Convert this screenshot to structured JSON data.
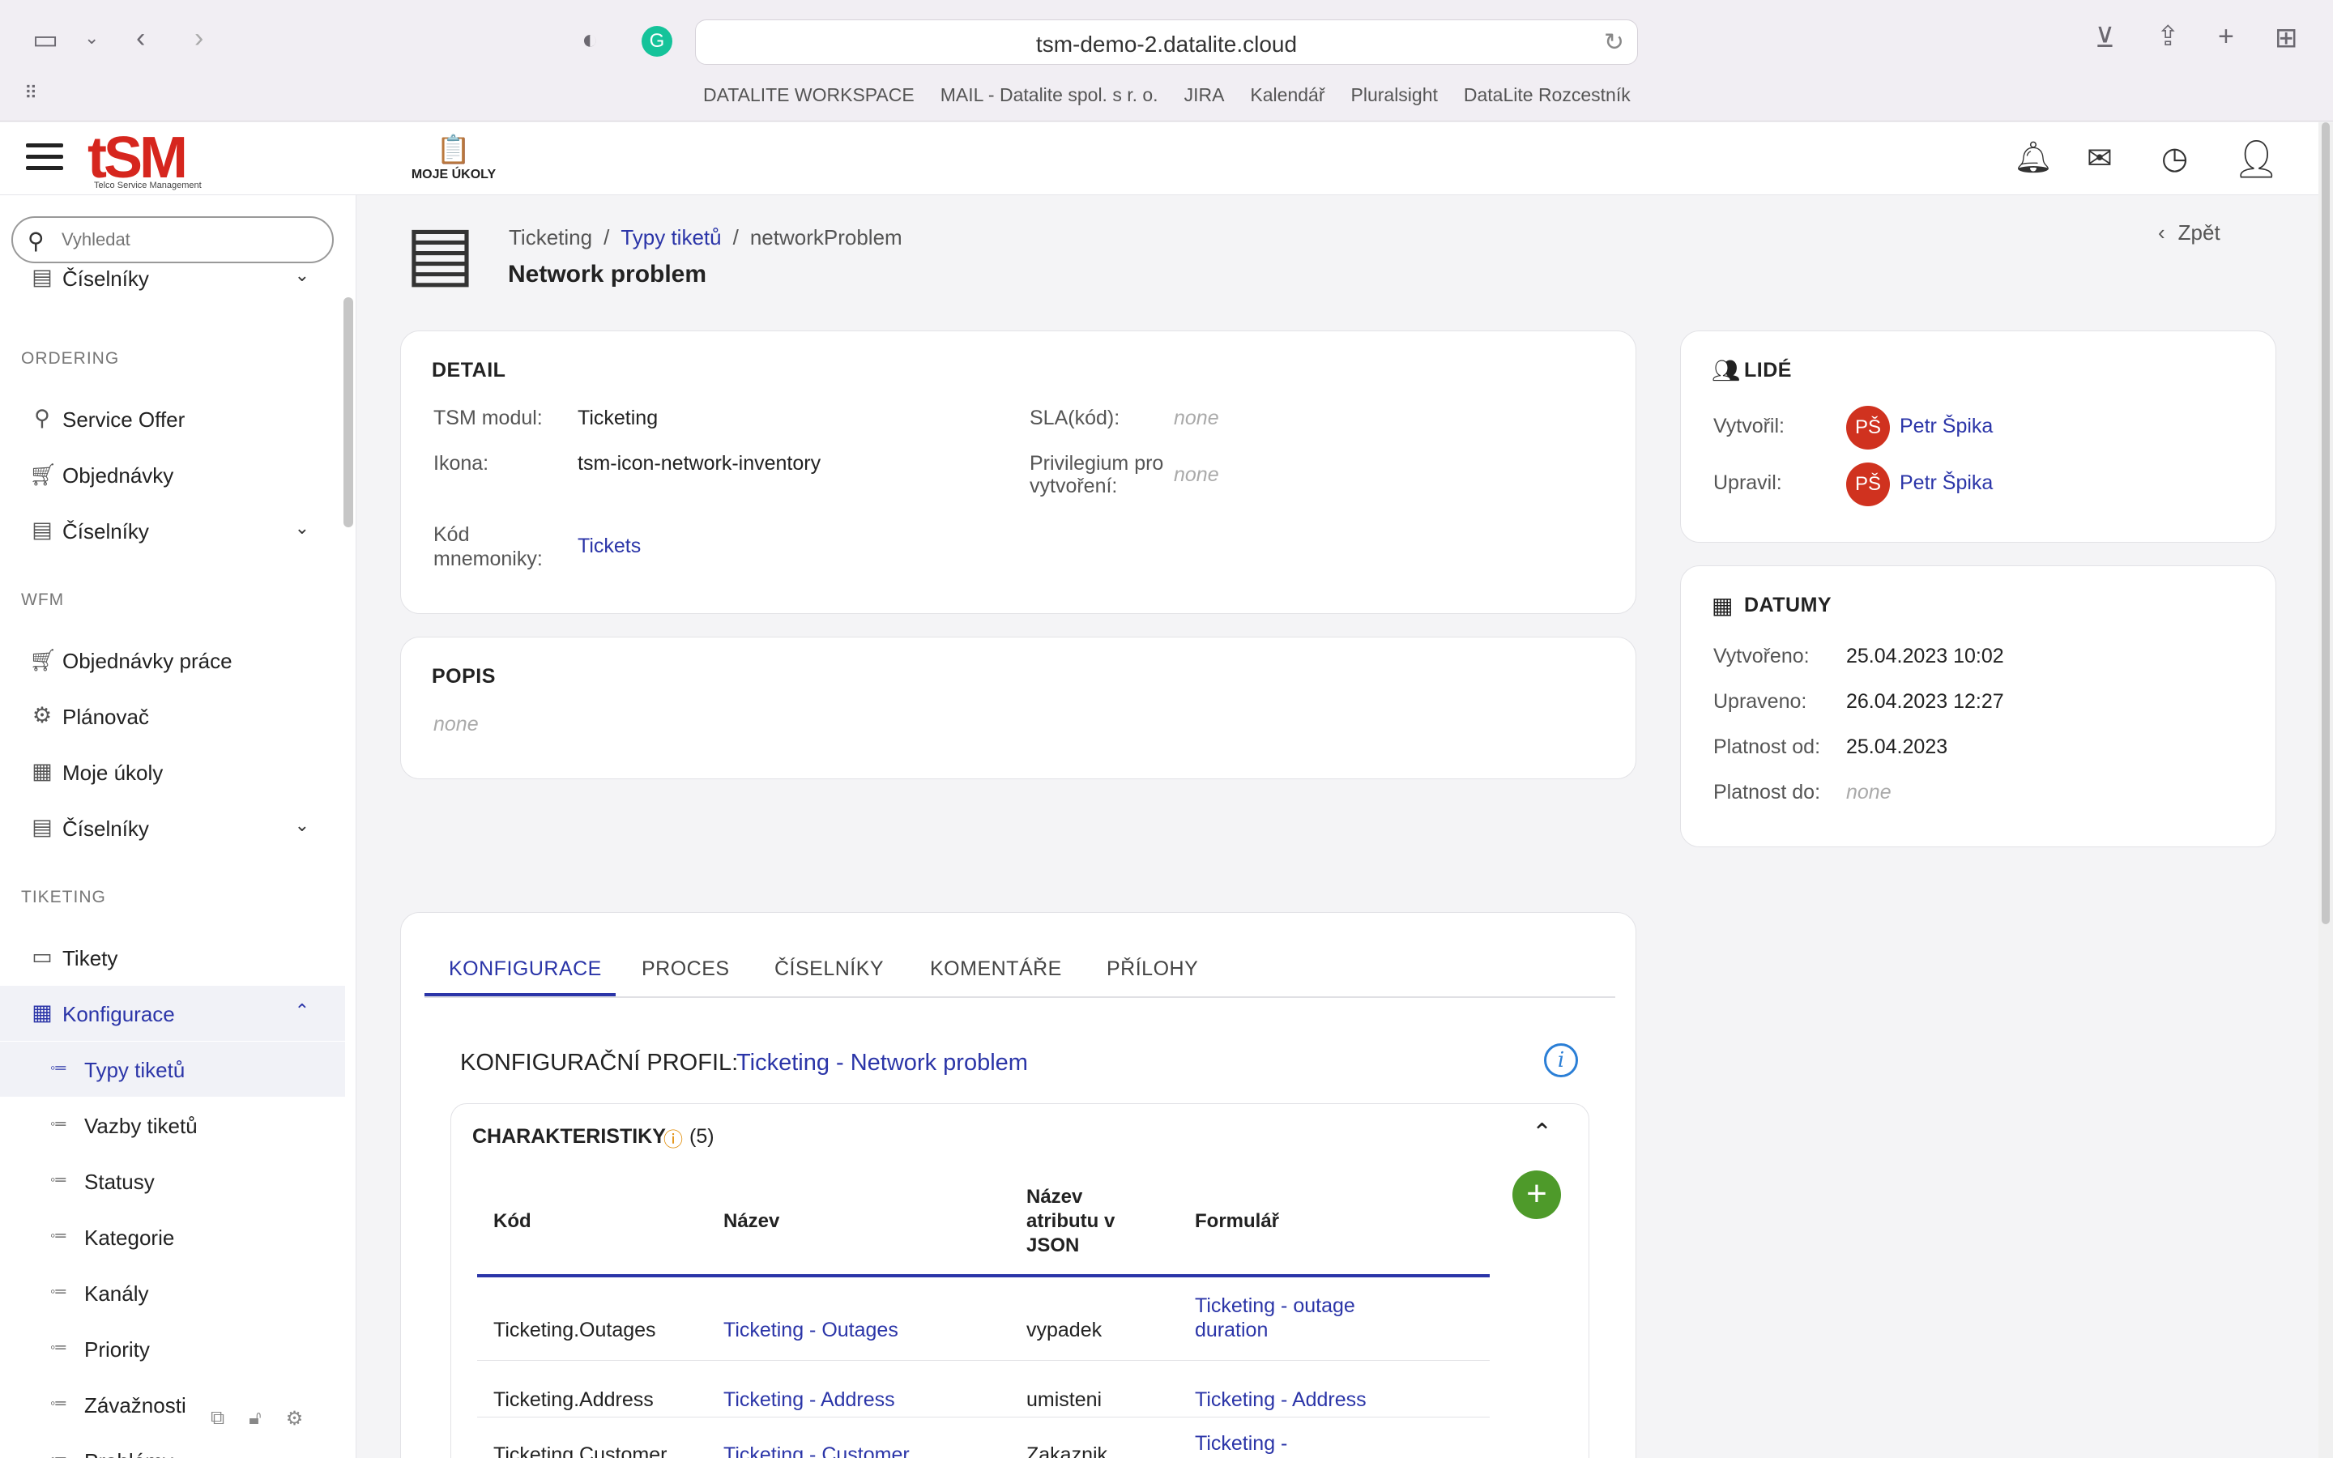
{
  "browser": {
    "url": "tsm-demo-2.datalite.cloud",
    "bookmarks": [
      "DATALITE WORKSPACE",
      "MAIL - Datalite spol. s r. o.",
      "JIRA",
      "Kalendář",
      "Pluralsight",
      "DataLite Rozcestník"
    ]
  },
  "header": {
    "logo_text": "tSM",
    "logo_sub": "Telco Service Management",
    "my_tasks_label": "MOJE ÚKOLY"
  },
  "sidebar": {
    "search_placeholder": "Vyhledat",
    "top_item": "Číselníky",
    "sections": {
      "ordering": "ORDERING",
      "wfm": "WFM",
      "tiketing": "TIKETING"
    },
    "ordering_items": [
      "Service Offer",
      "Objednávky",
      "Číselníky"
    ],
    "wfm_items": [
      "Objednávky práce",
      "Plánovač",
      "Moje úkoly",
      "Číselníky"
    ],
    "tiketing_items": [
      "Tikety",
      "Konfigurace"
    ],
    "konfigurace_sub": [
      "Typy tiketů",
      "Vazby tiketů",
      "Statusy",
      "Kategorie",
      "Kanály",
      "Priority",
      "Závažnosti",
      "Problémy"
    ]
  },
  "page": {
    "breadcrumb": [
      "Ticketing",
      "Typy tiketů",
      "networkProblem"
    ],
    "title": "Network problem",
    "back_label": "Zpět"
  },
  "detail": {
    "title": "DETAIL",
    "tsm_modul_label": "TSM modul:",
    "tsm_modul_value": "Ticketing",
    "ikona_label": "Ikona:",
    "ikona_value": "tsm-icon-network-inventory",
    "kod_label_1": "Kód",
    "kod_label_2": "mnemoniky:",
    "kod_value": "Tickets",
    "sla_label": "SLA(kód):",
    "sla_value": "none",
    "priv_label_1": "Privilegium pro",
    "priv_label_2": "vytvoření:",
    "priv_value": "none"
  },
  "popis": {
    "title": "POPIS",
    "value": "none"
  },
  "lide": {
    "title": "LIDÉ",
    "vytvoril_label": "Vytvořil:",
    "upravil_label": "Upravil:",
    "user_initials": "PŠ",
    "user_name": "Petr Špika"
  },
  "datumy": {
    "title": "DATUMY",
    "vytvoreno_label": "Vytvořeno:",
    "vytvoreno_value": "25.04.2023 10:02",
    "upraveno_label": "Upraveno:",
    "upraveno_value": "26.04.2023 12:27",
    "platnost_od_label": "Platnost od:",
    "platnost_od_value": "25.04.2023",
    "platnost_do_label": "Platnost do:",
    "platnost_do_value": "none"
  },
  "tabs": [
    "KONFIGURACE",
    "PROCES",
    "ČÍSELNÍKY",
    "KOMENTÁŘE",
    "PŘÍLOHY"
  ],
  "profile": {
    "label": "KONFIGURAČNÍ PROFIL:",
    "value": "Ticketing - Network problem"
  },
  "characteristics": {
    "title": "CHARAKTERISTIKY",
    "count": "(5)",
    "columns": {
      "kod": "Kód",
      "nazev": "Název",
      "json_1": "Název",
      "json_2": "atributu v",
      "json_3": "JSON",
      "formular": "Formulář"
    },
    "rows": [
      {
        "kod": "Ticketing.Outages",
        "nazev": "Ticketing - Outages",
        "json": "vypadek",
        "form_1": "Ticketing - outage",
        "form_2": "duration"
      },
      {
        "kod": "Ticketing.Address",
        "nazev": "Ticketing - Address",
        "json": "umisteni",
        "form_1": "Ticketing - Address",
        "form_2": ""
      },
      {
        "kod": "Ticketing.Customer",
        "nazev": "Ticketing - Customer",
        "json": "Zakaznik",
        "form_1": "Ticketing -",
        "form_2": ""
      }
    ]
  }
}
